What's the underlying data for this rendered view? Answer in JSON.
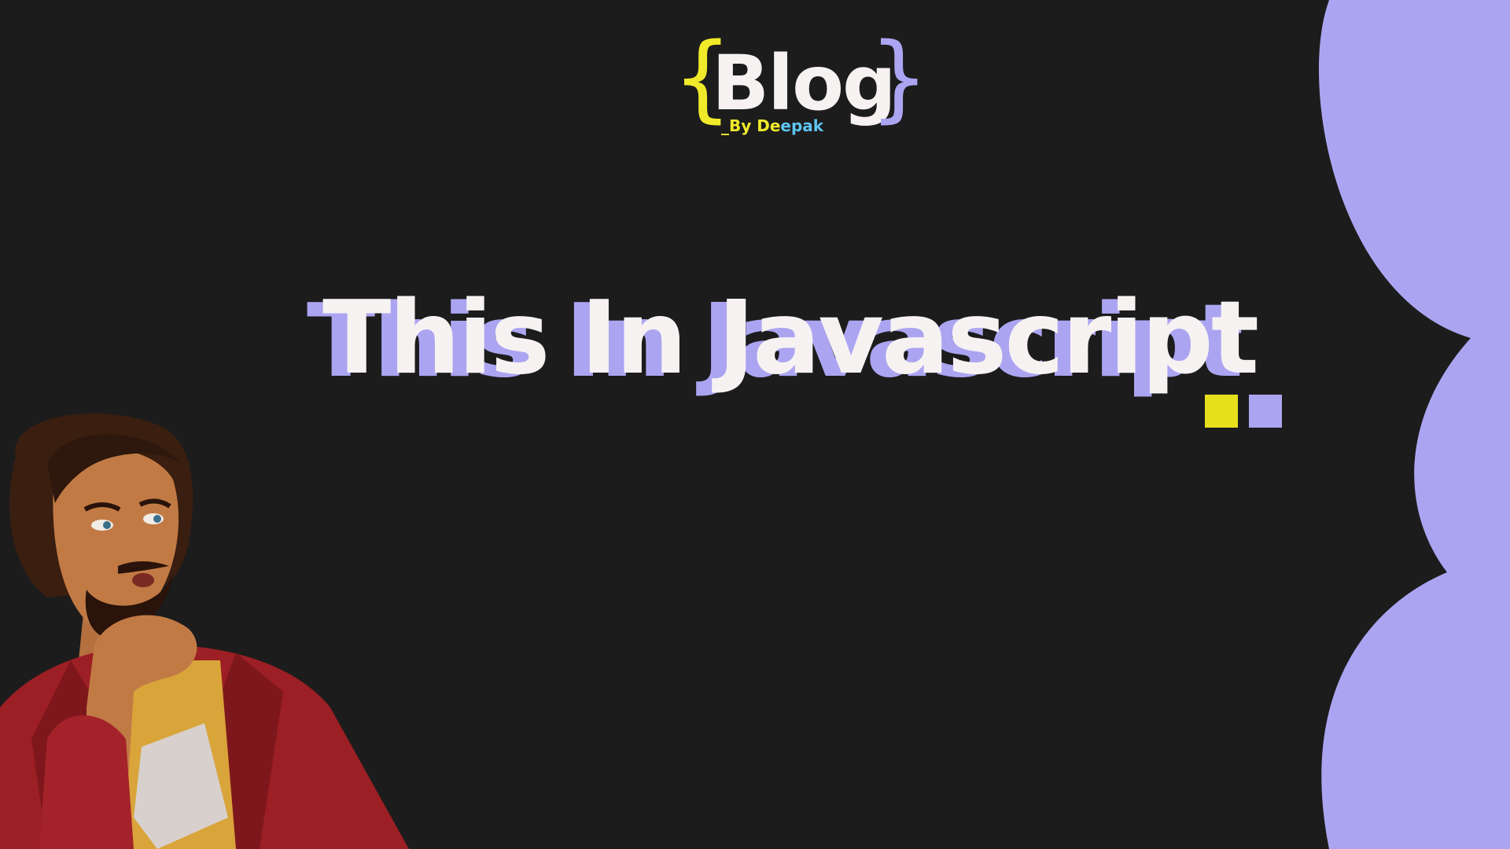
{
  "logo": {
    "brace_open": "{",
    "brace_close": "}",
    "word": "Blog",
    "byline": {
      "prefix": "_By De",
      "suffix": "epak"
    }
  },
  "title": {
    "text": "This In Javascript"
  },
  "colors": {
    "background": "#1c1c1c",
    "accent_purple": "#aba5f1",
    "accent_yellow": "#e6e01c",
    "text_light": "#f7f2f2",
    "byline_yellow": "#f0ea2a",
    "byline_blue": "#5ec4f0"
  },
  "decorations": {
    "squares": [
      "yellow",
      "purple"
    ],
    "right_shape": "purple-scalloped-edge",
    "character": "cartoon-man-thinking-red-jacket"
  }
}
